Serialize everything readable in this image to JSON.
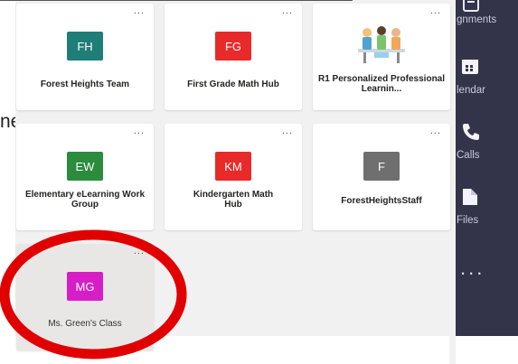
{
  "rail": {
    "items": [
      {
        "label": "gnments",
        "icon": "assignments-icon"
      },
      {
        "label": "lendar",
        "icon": "calendar-icon"
      },
      {
        "label": "Calls",
        "icon": "calls-icon"
      },
      {
        "label": "Files",
        "icon": "files-icon"
      }
    ],
    "more": "..."
  },
  "cutoff_text": "ne",
  "teams": [
    {
      "initials": "FH",
      "name": "Forest Heights Team",
      "color": "#1f7e77",
      "more": "..."
    },
    {
      "initials": "FG",
      "name": "First Grade Math Hub",
      "color": "#e82a2a",
      "more": "..."
    },
    {
      "initials": "",
      "name": "R1 Personalized Professional Learnin...",
      "color": "",
      "more": "...",
      "icon": "people-illustration-icon"
    },
    {
      "initials": "EW",
      "name": "Elementary eLearning Work Group",
      "color": "#2b8c3e",
      "more": "..."
    },
    {
      "initials": "KM",
      "name": "Kindergarten Math Hub",
      "color": "#e82a2a",
      "more": "..."
    },
    {
      "initials": "F",
      "name": "ForestHeightsStaff",
      "color": "#6f6f6f",
      "more": "..."
    },
    {
      "initials": "MG",
      "name": "Ms. Green's Class",
      "color": "#d71ec6",
      "more": "...",
      "selected": true
    }
  ],
  "annotation": {
    "shape": "circle",
    "color": "#e10000",
    "target": "Ms. Green's Class"
  }
}
